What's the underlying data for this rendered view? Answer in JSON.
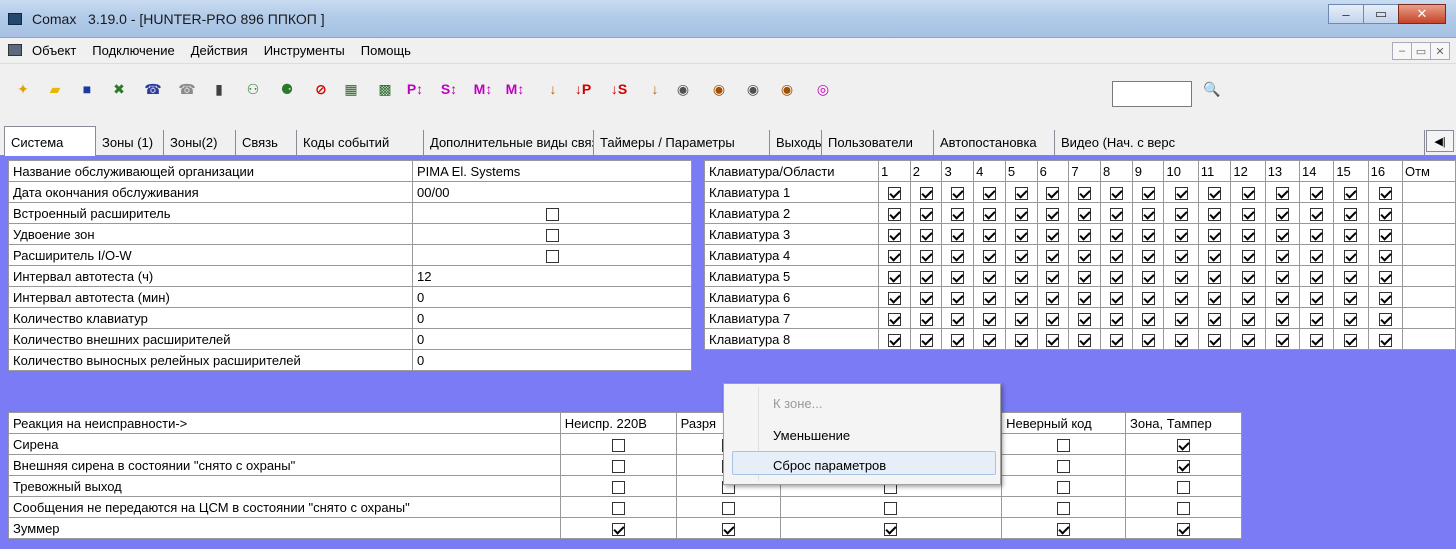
{
  "window": {
    "app_name": "Comax",
    "title": "3.19.0 - [HUNTER-PRO 896  ППКОП ]",
    "minimize": "–",
    "maximize": "▭",
    "close": "✕"
  },
  "menu": {
    "items": [
      "Объект",
      "Подключение",
      "Действия",
      "Инструменты",
      "Помощь"
    ],
    "mdi": [
      "–",
      "▭",
      "✕"
    ]
  },
  "toolbar": {
    "buttons": [
      {
        "icon": "new-document-icon",
        "glyph": "✦",
        "color": "#e0a000"
      },
      {
        "icon": "open-folder-icon",
        "glyph": "▰",
        "color": "#e8b800"
      },
      {
        "icon": "save-icon",
        "glyph": "■",
        "color": "#1a3a9c"
      },
      {
        "icon": "excel-icon",
        "glyph": "✖",
        "color": "#2a7a2a"
      },
      {
        "icon": "modem-icon",
        "glyph": "☎",
        "color": "#2a3aa0"
      },
      {
        "icon": "modem-disabled-icon",
        "glyph": "☎",
        "color": "#8a8a8a"
      },
      {
        "icon": "phone-icon",
        "glyph": "▮",
        "color": "#404040"
      },
      {
        "icon": "connect-icon",
        "glyph": "⚇",
        "color": "#2a7a2a"
      },
      {
        "icon": "disconnect-icon",
        "glyph": "⚈",
        "color": "#2a7a2a"
      },
      {
        "icon": "stop-icon",
        "glyph": "⊘",
        "color": "#d00000"
      },
      {
        "icon": "download-icon",
        "glyph": "▦",
        "color": "#2a6a2a"
      },
      {
        "icon": "upload-icon",
        "glyph": "▩",
        "color": "#2a6a2a"
      },
      {
        "icon": "p-transfer-icon",
        "glyph": "P↕",
        "color": "#c000c0"
      },
      {
        "icon": "s-transfer-icon",
        "glyph": "S↕",
        "color": "#c000c0"
      },
      {
        "icon": "m-transfer-icon",
        "glyph": "M↕",
        "color": "#c000c0"
      },
      {
        "icon": "m-transfer-2-icon",
        "glyph": "M↕",
        "color": "#c000c0"
      },
      {
        "icon": "read-icon",
        "glyph": "↓",
        "color": "#c06000"
      },
      {
        "icon": "read-p-icon",
        "glyph": "↓P",
        "color": "#d00000"
      },
      {
        "icon": "read-s-icon",
        "glyph": "↓S",
        "color": "#d00000"
      },
      {
        "icon": "write-icon",
        "glyph": "↓",
        "color": "#c06000"
      },
      {
        "icon": "camera-icon",
        "glyph": "◉",
        "color": "#505050"
      },
      {
        "icon": "camera-1-icon",
        "glyph": "◉",
        "color": "#a05000"
      },
      {
        "icon": "camera-2-icon",
        "glyph": "◉",
        "color": "#505050"
      },
      {
        "icon": "camera-3-icon",
        "glyph": "◉",
        "color": "#a05000"
      },
      {
        "icon": "globe-icon",
        "glyph": "◎",
        "color": "#c000c0"
      }
    ],
    "find_icon": "🔍"
  },
  "tabs": [
    {
      "label": "Система",
      "active": true
    },
    {
      "label": "Зоны (1)"
    },
    {
      "label": "Зоны(2)"
    },
    {
      "label": "Связь"
    },
    {
      "label": "Коды событий"
    },
    {
      "label": "Дополнительные виды связи"
    },
    {
      "label": "Таймеры / Параметры"
    },
    {
      "label": "Выходы"
    },
    {
      "label": "Пользователи"
    },
    {
      "label": "Автопостановка"
    },
    {
      "label": "Видео (Нач. с верс"
    }
  ],
  "tab_scroll": "◀|",
  "system_table": [
    {
      "label": "Название обслуживающей организации",
      "value": "PIMA El. Systems"
    },
    {
      "label": "Дата окончания обслуживания",
      "value": "00/00"
    },
    {
      "label": "Встроенный расширитель",
      "checkbox": false
    },
    {
      "label": "Удвоение зон",
      "checkbox": false
    },
    {
      "label": "Расширитель I/O-W",
      "checkbox": false
    },
    {
      "label": "Интервал автотеста (ч)",
      "value": "12"
    },
    {
      "label": "Интервал автотеста (мин)",
      "value": "0"
    },
    {
      "label": "Количество клавиатур",
      "value": "0"
    },
    {
      "label": "Количество внешних расширителей",
      "value": "0"
    },
    {
      "label": "Количество выносных релейных расширителей",
      "value": "0"
    }
  ],
  "keypad_table": {
    "corner": "Клавиатура/Области",
    "columns": [
      "1",
      "2",
      "3",
      "4",
      "5",
      "6",
      "7",
      "8",
      "9",
      "10",
      "11",
      "12",
      "13",
      "14",
      "15",
      "16",
      "Отм"
    ],
    "rows": [
      "Клавиатура 1",
      "Клавиатура 2",
      "Клавиатура 3",
      "Клавиатура 4",
      "Клавиатура 5",
      "Клавиатура 6",
      "Клавиатура 7",
      "Клавиатура 8"
    ]
  },
  "fault_table": {
    "header": "Реакция на неисправности->",
    "columns": [
      "Неиспр. 220В",
      "Разря",
      "",
      "Неверный код",
      "Зона, Тампер"
    ],
    "rows": [
      {
        "label": "Сирена",
        "checks": [
          false,
          false,
          false,
          false,
          true
        ]
      },
      {
        "label": "Внешняя сирена в состоянии \"снято с охраны\"",
        "checks": [
          false,
          false,
          false,
          false,
          true
        ]
      },
      {
        "label": "Тревожный выход",
        "checks": [
          false,
          false,
          false,
          false,
          false
        ]
      },
      {
        "label": "Сообщения не передаются на ЦСМ в состоянии \"снято с охраны\"",
        "checks": [
          false,
          false,
          false,
          false,
          false
        ]
      },
      {
        "label": "Зуммер",
        "checks": [
          true,
          true,
          true,
          true,
          true
        ]
      }
    ]
  },
  "context_menu": {
    "items": [
      {
        "label": "К зоне...",
        "disabled": true
      },
      {
        "label": "Уменьшение"
      },
      {
        "label": "Сброс параметров",
        "highlighted": true
      }
    ]
  }
}
